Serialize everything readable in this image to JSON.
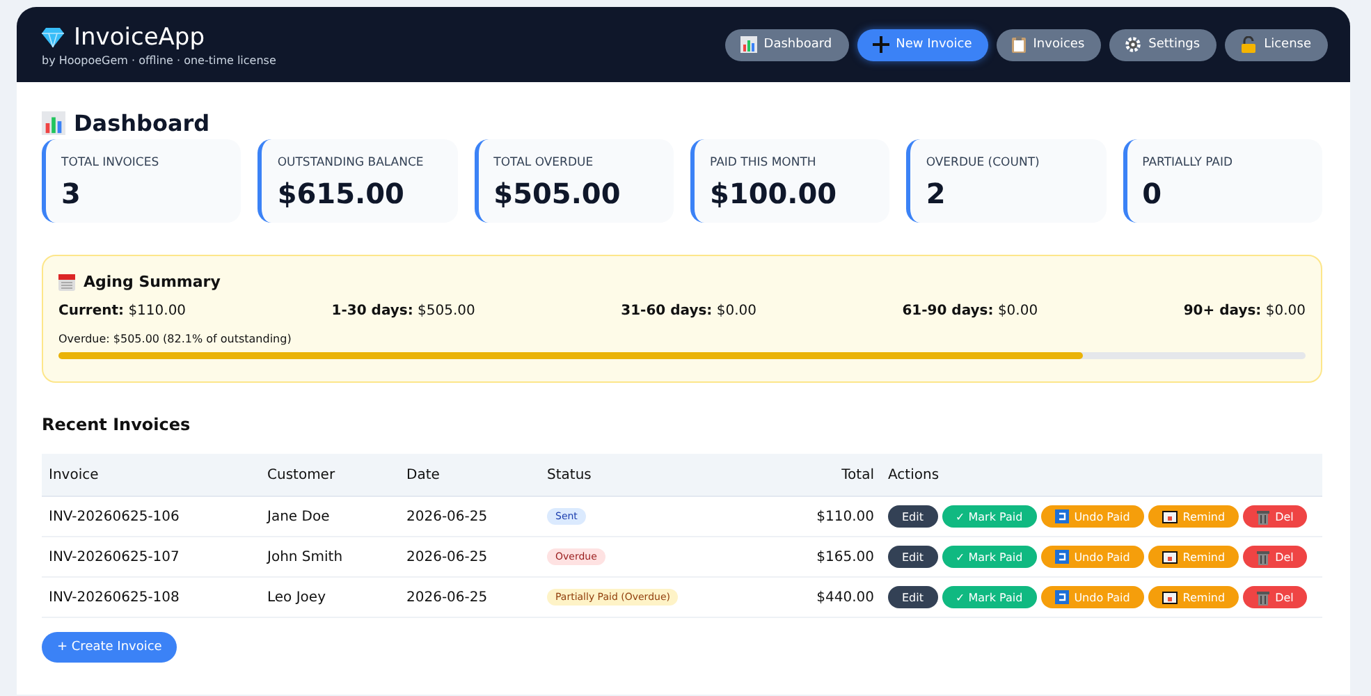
{
  "header": {
    "title": "InvoiceApp",
    "subtitle": "by HoopoeGem · offline · one-time license",
    "nav": [
      {
        "label": "Dashboard",
        "kind": "default"
      },
      {
        "label": "New Invoice",
        "kind": "primary"
      },
      {
        "label": "Invoices",
        "kind": "default"
      },
      {
        "label": "Settings",
        "kind": "default"
      },
      {
        "label": "License",
        "kind": "default"
      }
    ]
  },
  "page_title": "Dashboard",
  "stats": [
    {
      "label": "TOTAL INVOICES",
      "value": "3"
    },
    {
      "label": "OUTSTANDING BALANCE",
      "value": "$615.00"
    },
    {
      "label": "TOTAL OVERDUE",
      "value": "$505.00"
    },
    {
      "label": "PAID THIS MONTH",
      "value": "$100.00"
    },
    {
      "label": "OVERDUE (COUNT)",
      "value": "2"
    },
    {
      "label": "PARTIALLY PAID",
      "value": "0"
    }
  ],
  "aging": {
    "title": "Aging Summary",
    "buckets": [
      {
        "label": "Current:",
        "value": "$110.00"
      },
      {
        "label": "1-30 days:",
        "value": "$505.00"
      },
      {
        "label": "31-60 days:",
        "value": "$0.00"
      },
      {
        "label": "61-90 days:",
        "value": "$0.00"
      },
      {
        "label": "90+ days:",
        "value": "$0.00"
      }
    ],
    "overdue_note": "Overdue: $505.00 (82.1% of outstanding)",
    "level": 0.821
  },
  "recent": {
    "title": "Recent Invoices",
    "columns": [
      "Invoice",
      "Customer",
      "Date",
      "Status",
      "Total",
      "Actions"
    ],
    "rows": [
      {
        "invoice": "INV-20260625-106",
        "customer": "Jane Doe",
        "date": "2026-06-25",
        "status": {
          "label": "Sent",
          "kind": "sent"
        },
        "total": "$110.00",
        "actions": [
          {
            "kind": "edit",
            "label": "Edit"
          },
          {
            "kind": "mark",
            "label": "✓ Mark Paid"
          },
          {
            "kind": "undo",
            "label": "Undo Paid"
          },
          {
            "kind": "remind",
            "label": "Remind"
          },
          {
            "kind": "del",
            "label": "Del"
          }
        ]
      },
      {
        "invoice": "INV-20260625-107",
        "customer": "John Smith",
        "date": "2026-06-25",
        "status": {
          "label": "Overdue",
          "kind": "overdue"
        },
        "total": "$165.00",
        "actions": [
          {
            "kind": "edit",
            "label": "Edit"
          },
          {
            "kind": "mark",
            "label": "✓ Mark Paid"
          },
          {
            "kind": "undo",
            "label": "Undo Paid"
          },
          {
            "kind": "remind",
            "label": "Remind"
          },
          {
            "kind": "del",
            "label": "Del"
          }
        ]
      },
      {
        "invoice": "INV-20260625-108",
        "customer": "Leo Joey",
        "date": "2026-06-25",
        "status": {
          "label": "Partially Paid (Overdue)",
          "kind": "partial"
        },
        "total": "$440.00",
        "actions": [
          {
            "kind": "edit",
            "label": "Edit"
          },
          {
            "kind": "mark",
            "label": "✓ Mark Paid"
          },
          {
            "kind": "undo",
            "label": "Undo Paid"
          },
          {
            "kind": "remind",
            "label": "Remind"
          },
          {
            "kind": "del",
            "label": "Del"
          }
        ]
      }
    ],
    "create_button": "+ Create Invoice"
  }
}
